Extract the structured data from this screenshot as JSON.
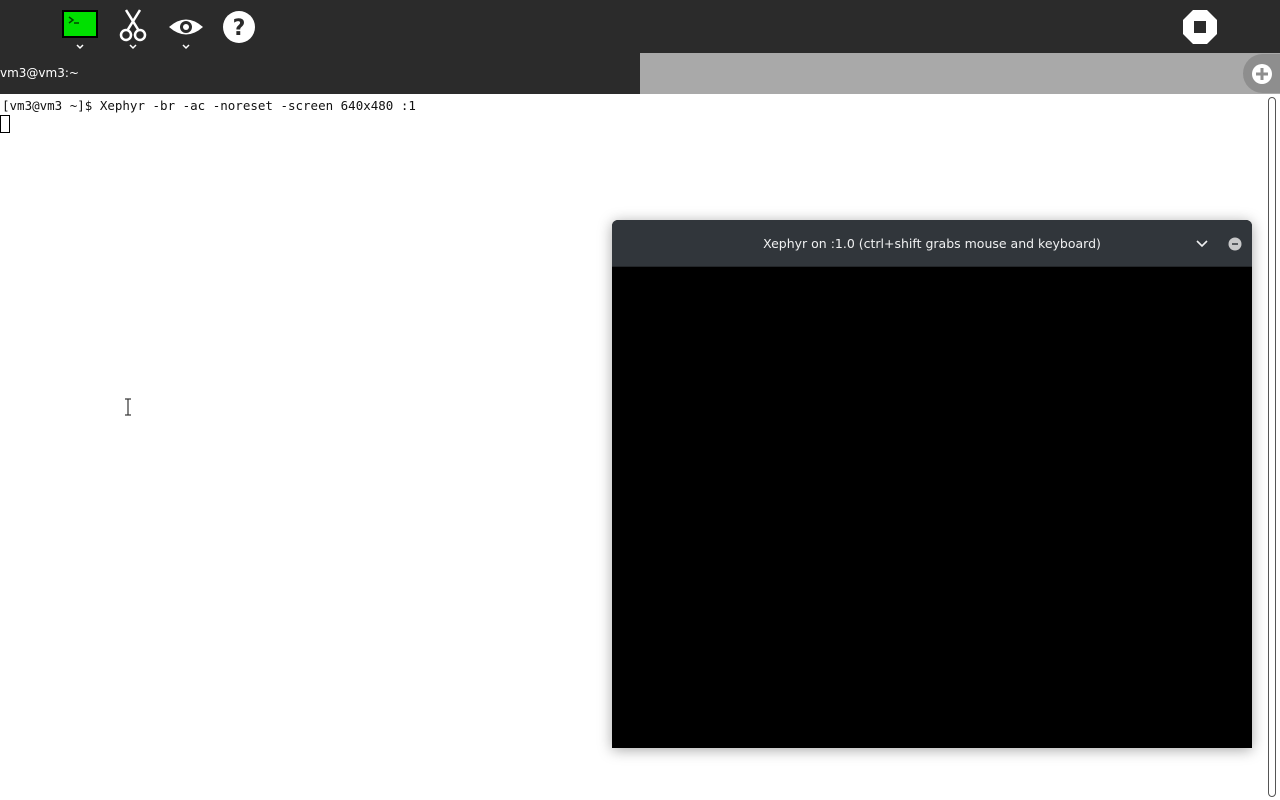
{
  "toolbar": {
    "buttons": [
      {
        "name": "terminal",
        "icon": "terminal-icon"
      },
      {
        "name": "cut",
        "icon": "scissors-icon"
      },
      {
        "name": "view",
        "icon": "eye-icon"
      },
      {
        "name": "help",
        "icon": "help-icon"
      },
      {
        "name": "stop",
        "icon": "stop-icon"
      }
    ]
  },
  "tabs": [
    {
      "label": "vm3@vm3:~",
      "active": true
    }
  ],
  "terminal": {
    "command_line": "[vm3@vm3 ~]$ Xephyr -br -ac -noreset -screen 640x480 :1"
  },
  "xephyr_window": {
    "title": "Xephyr on :1.0 (ctrl+shift grabs mouse and keyboard)"
  },
  "colors": {
    "toolbar_bg": "#2b2b2b",
    "terminal_icon_green": "#00e000",
    "tab_inactive_bg": "#a9a9a9",
    "window_titlebar": "#31363b"
  }
}
